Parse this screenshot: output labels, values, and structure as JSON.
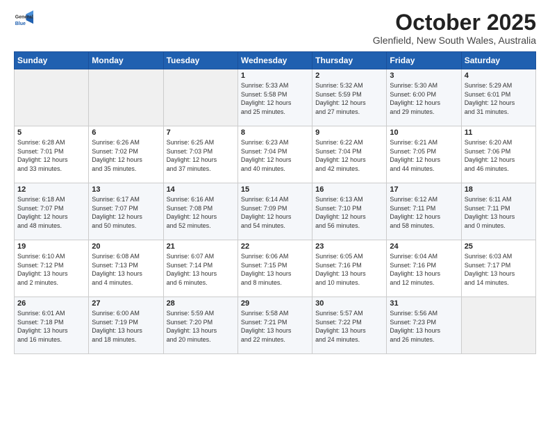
{
  "logo": {
    "line1": "General",
    "line2": "Blue"
  },
  "title": "October 2025",
  "location": "Glenfield, New South Wales, Australia",
  "days_header": [
    "Sunday",
    "Monday",
    "Tuesday",
    "Wednesday",
    "Thursday",
    "Friday",
    "Saturday"
  ],
  "weeks": [
    [
      {
        "day": "",
        "info": ""
      },
      {
        "day": "",
        "info": ""
      },
      {
        "day": "",
        "info": ""
      },
      {
        "day": "1",
        "info": "Sunrise: 5:33 AM\nSunset: 5:58 PM\nDaylight: 12 hours\nand 25 minutes."
      },
      {
        "day": "2",
        "info": "Sunrise: 5:32 AM\nSunset: 5:59 PM\nDaylight: 12 hours\nand 27 minutes."
      },
      {
        "day": "3",
        "info": "Sunrise: 5:30 AM\nSunset: 6:00 PM\nDaylight: 12 hours\nand 29 minutes."
      },
      {
        "day": "4",
        "info": "Sunrise: 5:29 AM\nSunset: 6:01 PM\nDaylight: 12 hours\nand 31 minutes."
      }
    ],
    [
      {
        "day": "5",
        "info": "Sunrise: 6:28 AM\nSunset: 7:01 PM\nDaylight: 12 hours\nand 33 minutes."
      },
      {
        "day": "6",
        "info": "Sunrise: 6:26 AM\nSunset: 7:02 PM\nDaylight: 12 hours\nand 35 minutes."
      },
      {
        "day": "7",
        "info": "Sunrise: 6:25 AM\nSunset: 7:03 PM\nDaylight: 12 hours\nand 37 minutes."
      },
      {
        "day": "8",
        "info": "Sunrise: 6:23 AM\nSunset: 7:04 PM\nDaylight: 12 hours\nand 40 minutes."
      },
      {
        "day": "9",
        "info": "Sunrise: 6:22 AM\nSunset: 7:04 PM\nDaylight: 12 hours\nand 42 minutes."
      },
      {
        "day": "10",
        "info": "Sunrise: 6:21 AM\nSunset: 7:05 PM\nDaylight: 12 hours\nand 44 minutes."
      },
      {
        "day": "11",
        "info": "Sunrise: 6:20 AM\nSunset: 7:06 PM\nDaylight: 12 hours\nand 46 minutes."
      }
    ],
    [
      {
        "day": "12",
        "info": "Sunrise: 6:18 AM\nSunset: 7:07 PM\nDaylight: 12 hours\nand 48 minutes."
      },
      {
        "day": "13",
        "info": "Sunrise: 6:17 AM\nSunset: 7:07 PM\nDaylight: 12 hours\nand 50 minutes."
      },
      {
        "day": "14",
        "info": "Sunrise: 6:16 AM\nSunset: 7:08 PM\nDaylight: 12 hours\nand 52 minutes."
      },
      {
        "day": "15",
        "info": "Sunrise: 6:14 AM\nSunset: 7:09 PM\nDaylight: 12 hours\nand 54 minutes."
      },
      {
        "day": "16",
        "info": "Sunrise: 6:13 AM\nSunset: 7:10 PM\nDaylight: 12 hours\nand 56 minutes."
      },
      {
        "day": "17",
        "info": "Sunrise: 6:12 AM\nSunset: 7:11 PM\nDaylight: 12 hours\nand 58 minutes."
      },
      {
        "day": "18",
        "info": "Sunrise: 6:11 AM\nSunset: 7:11 PM\nDaylight: 13 hours\nand 0 minutes."
      }
    ],
    [
      {
        "day": "19",
        "info": "Sunrise: 6:10 AM\nSunset: 7:12 PM\nDaylight: 13 hours\nand 2 minutes."
      },
      {
        "day": "20",
        "info": "Sunrise: 6:08 AM\nSunset: 7:13 PM\nDaylight: 13 hours\nand 4 minutes."
      },
      {
        "day": "21",
        "info": "Sunrise: 6:07 AM\nSunset: 7:14 PM\nDaylight: 13 hours\nand 6 minutes."
      },
      {
        "day": "22",
        "info": "Sunrise: 6:06 AM\nSunset: 7:15 PM\nDaylight: 13 hours\nand 8 minutes."
      },
      {
        "day": "23",
        "info": "Sunrise: 6:05 AM\nSunset: 7:16 PM\nDaylight: 13 hours\nand 10 minutes."
      },
      {
        "day": "24",
        "info": "Sunrise: 6:04 AM\nSunset: 7:16 PM\nDaylight: 13 hours\nand 12 minutes."
      },
      {
        "day": "25",
        "info": "Sunrise: 6:03 AM\nSunset: 7:17 PM\nDaylight: 13 hours\nand 14 minutes."
      }
    ],
    [
      {
        "day": "26",
        "info": "Sunrise: 6:01 AM\nSunset: 7:18 PM\nDaylight: 13 hours\nand 16 minutes."
      },
      {
        "day": "27",
        "info": "Sunrise: 6:00 AM\nSunset: 7:19 PM\nDaylight: 13 hours\nand 18 minutes."
      },
      {
        "day": "28",
        "info": "Sunrise: 5:59 AM\nSunset: 7:20 PM\nDaylight: 13 hours\nand 20 minutes."
      },
      {
        "day": "29",
        "info": "Sunrise: 5:58 AM\nSunset: 7:21 PM\nDaylight: 13 hours\nand 22 minutes."
      },
      {
        "day": "30",
        "info": "Sunrise: 5:57 AM\nSunset: 7:22 PM\nDaylight: 13 hours\nand 24 minutes."
      },
      {
        "day": "31",
        "info": "Sunrise: 5:56 AM\nSunset: 7:23 PM\nDaylight: 13 hours\nand 26 minutes."
      },
      {
        "day": "",
        "info": ""
      }
    ]
  ]
}
